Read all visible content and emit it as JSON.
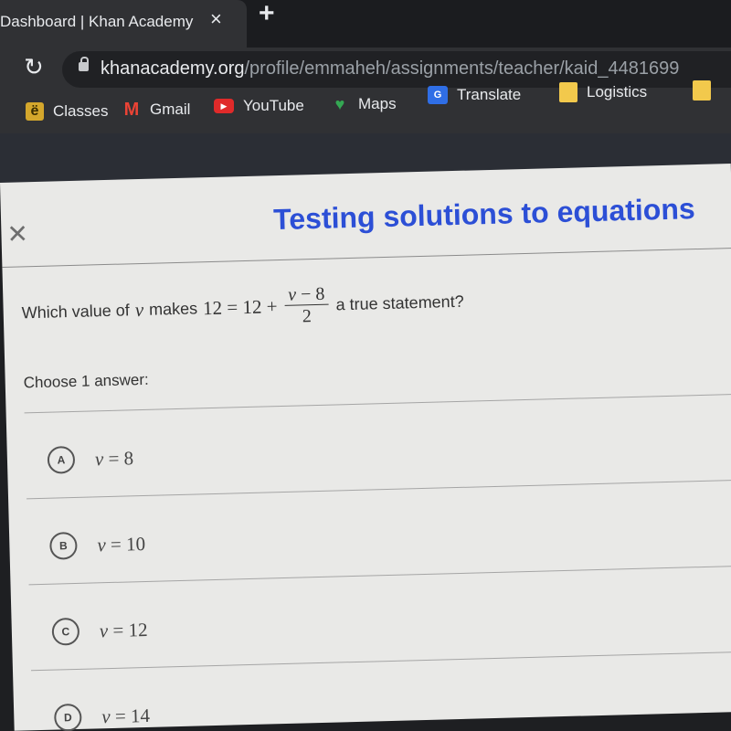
{
  "browser": {
    "tab_title": "Dashboard | Khan Academy",
    "tab_close_icon": "×",
    "new_tab_icon": "+",
    "reload_icon": "↻",
    "url_host": "khanacademy.org",
    "url_path": "/profile/emmaheh/assignments/teacher/kaid_4481699",
    "bookmarks": [
      {
        "label": "Classes",
        "icon": "ë"
      },
      {
        "label": "Gmail",
        "icon": "M"
      },
      {
        "label": "YouTube",
        "icon": "▶"
      },
      {
        "label": "Maps",
        "icon": "♥"
      },
      {
        "label": "Translate",
        "icon": "G"
      },
      {
        "label": "Logistics",
        "icon": ""
      }
    ]
  },
  "exercise": {
    "close_icon": "✕",
    "title": "Testing solutions to equations",
    "question": {
      "prefix": "Which value of",
      "variable": "v",
      "middle": "makes",
      "lhs": "12 = 12 +",
      "frac_num_var": "v",
      "frac_num_rest": " − 8",
      "frac_den": "2",
      "suffix": "a true statement?"
    },
    "choose_label": "Choose 1 answer:",
    "choices": [
      {
        "letter": "A",
        "var": "v",
        "rest": " = 8"
      },
      {
        "letter": "B",
        "var": "v",
        "rest": " = 10"
      },
      {
        "letter": "C",
        "var": "v",
        "rest": " = 12"
      },
      {
        "letter": "D",
        "var": "v",
        "rest": " = 14"
      }
    ]
  }
}
